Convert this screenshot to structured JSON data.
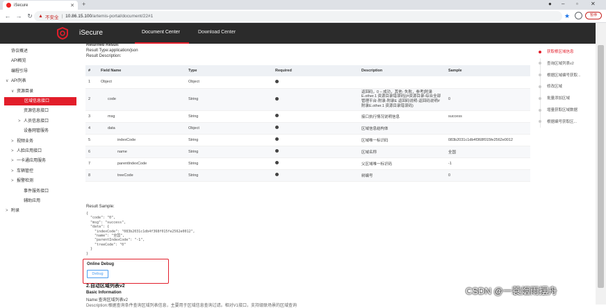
{
  "browser": {
    "tab_title": "iSecure",
    "insecure_label": "不安全",
    "url_host": "10.86.15.100",
    "url_path": "/artemis-portal/document/22#1",
    "paused_label": "暂停"
  },
  "header": {
    "brand": "iSecure",
    "nav": [
      "Document Center",
      "Download Center"
    ],
    "active_nav": "Document Center",
    "accent_color": "#e21d2a"
  },
  "sidebar": {
    "items": [
      {
        "label": "协议概述",
        "indent": 0,
        "caret": ""
      },
      {
        "label": "API概览",
        "indent": 0,
        "caret": ""
      },
      {
        "label": "编程引导",
        "indent": 0,
        "caret": ""
      },
      {
        "label": "API列表",
        "indent": 0,
        "caret": "∨"
      },
      {
        "label": "资源目录",
        "indent": 1,
        "caret": "∨"
      },
      {
        "label": "区域信息接口",
        "indent": 2,
        "caret": "",
        "active": true
      },
      {
        "label": "资源信息接口",
        "indent": 2,
        "caret": ""
      },
      {
        "label": "人员信息接口",
        "indent": 2,
        "caret": ">"
      },
      {
        "label": "设备网管服务",
        "indent": 2,
        "caret": ""
      },
      {
        "label": "视频业务",
        "indent": 1,
        "caret": ">"
      },
      {
        "label": "人脸应用接口",
        "indent": 1,
        "caret": ">"
      },
      {
        "label": "一卡通应用服务",
        "indent": 1,
        "caret": ">"
      },
      {
        "label": "车辆管控",
        "indent": 1,
        "caret": ">"
      },
      {
        "label": "报警检测",
        "indent": 1,
        "caret": ">"
      },
      {
        "label": "事件服务接口",
        "indent": 2,
        "caret": ""
      },
      {
        "label": "辅助应用",
        "indent": 2,
        "caret": ""
      },
      {
        "label": "附录",
        "indent": 0,
        "caret": ">"
      }
    ]
  },
  "content": {
    "returned_result": "Returned Result",
    "result_type": "Result Type:application/json",
    "result_description": "Result Description:",
    "columns": [
      "#",
      "Field Name",
      "Type",
      "Required",
      "Description",
      "Sample"
    ],
    "rows": [
      {
        "num": "1",
        "field": "Object",
        "level": 0,
        "type": "Object",
        "required": true,
        "description": "",
        "sample": ""
      },
      {
        "num": "2",
        "field": "code",
        "level": 1,
        "type": "String",
        "required": true,
        "description": "返回码，0 – 成功，其他- 失败，参考[附录E.other.1 资源目录错误码](#资源目录-综合全部管理平台-附录-附录E 返回码说明-返回码说明#附录E.other.1 资源目录错误码)",
        "sample": "0"
      },
      {
        "num": "3",
        "field": "msg",
        "level": 1,
        "type": "String",
        "required": true,
        "description": "接口执行情况说明信息",
        "sample": "success"
      },
      {
        "num": "4",
        "field": "data",
        "level": 1,
        "type": "Object",
        "required": true,
        "description": "区域信息结构体",
        "sample": ""
      },
      {
        "num": "5",
        "field": "indexCode",
        "level": 2,
        "type": "String",
        "required": true,
        "description": "区域唯一标识码",
        "sample": "083b2031c1db4f368f015fe2562e0012"
      },
      {
        "num": "6",
        "field": "name",
        "level": 2,
        "type": "String",
        "required": true,
        "description": "区域名称",
        "sample": "全国"
      },
      {
        "num": "7",
        "field": "parentIndexCode",
        "level": 2,
        "type": "String",
        "required": true,
        "description": "父区域唯一标识码",
        "sample": "-1"
      },
      {
        "num": "8",
        "field": "treeCode",
        "level": 2,
        "type": "String",
        "required": true,
        "description": "树编号",
        "sample": "0"
      }
    ],
    "result_sample_label": "Result Sample:",
    "result_sample": "{\n  \"code\": \"0\",\n  \"msg\": \"success\",\n  \"data\": {\n    \"indexCode\": \"083b2031c1db4f368f015fe2562e0012\",\n    \"name\": \"全国\",\n    \"parentIndexCode\": \"-1\",\n    \"treeCode\": \"0\"\n  }\n}",
    "online_debug": "Online Debug",
    "debug_button": "Debug",
    "next_title": "2.自动区域列表v2",
    "basic_information": "Basic Information",
    "next_name": "Name:查询区域列表v2",
    "next_description": "Description:根据查询条件查询区域列表信息，主要用于区域信息查询过滤。相对V1接口，支持级联场景的区域查询"
  },
  "anchors": {
    "items": [
      "获取根区域信息",
      "查询区域列表v2",
      "根据区域编号获取...",
      "修改区域",
      "批量添加区域",
      "增量获取区域数据",
      "根据编号获取区..."
    ],
    "active_index": 0
  },
  "watermark": "CSDN @一蓑烟雨摆舟"
}
